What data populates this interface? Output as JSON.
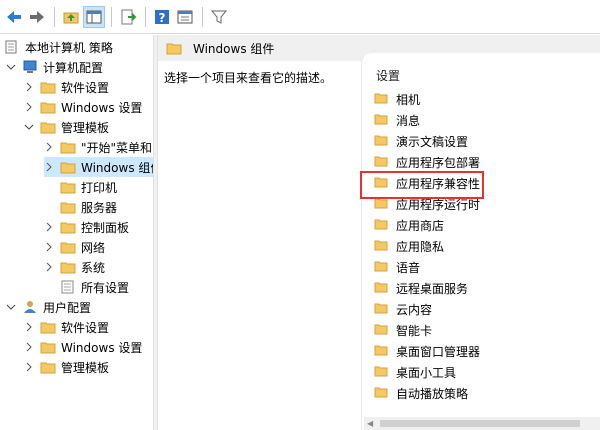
{
  "toolbar": {
    "buttons": [
      {
        "name": "back-arrow-icon"
      },
      {
        "name": "forward-arrow-icon"
      },
      {
        "name": "up-folder-icon"
      },
      {
        "name": "show-hide-tree-icon"
      },
      {
        "name": "export-list-icon"
      },
      {
        "name": "help-icon"
      },
      {
        "name": "properties-view-icon"
      },
      {
        "name": "filter-icon"
      }
    ]
  },
  "tree": {
    "items": [
      {
        "label": "本地计算机 策略",
        "level": 0,
        "expanded": true
      },
      {
        "label": "计算机配置",
        "level": 1,
        "expanded": true
      },
      {
        "label": "软件设置",
        "level": 2,
        "expanded": false
      },
      {
        "label": "Windows 设置",
        "level": 2,
        "expanded": false
      },
      {
        "label": "管理模板",
        "level": 2,
        "expanded": true
      },
      {
        "label": "\"开始\"菜单和",
        "level": 3,
        "expanded": false
      },
      {
        "label": "Windows 组件",
        "level": 3,
        "expanded": false,
        "selected": true
      },
      {
        "label": "打印机",
        "level": 3
      },
      {
        "label": "服务器",
        "level": 3
      },
      {
        "label": "控制面板",
        "level": 3,
        "expanded": false
      },
      {
        "label": "网络",
        "level": 3,
        "expanded": false
      },
      {
        "label": "系统",
        "level": 3,
        "expanded": false
      },
      {
        "label": "所有设置",
        "level": 3
      },
      {
        "label": "用户配置",
        "level": 1,
        "expanded": true
      },
      {
        "label": "软件设置",
        "level": 2,
        "expanded": false
      },
      {
        "label": "Windows 设置",
        "level": 2,
        "expanded": false
      },
      {
        "label": "管理模板",
        "level": 2,
        "expanded": false
      }
    ]
  },
  "right": {
    "header_title": "Windows 组件",
    "description": "选择一个项目来查看它的描述。",
    "column_header": "设置",
    "items": [
      "相机",
      "消息",
      "演示文稿设置",
      "应用程序包部署",
      "应用程序兼容性",
      "应用程序运行时",
      "应用商店",
      "应用隐私",
      "语音",
      "远程桌面服务",
      "云内容",
      "智能卡",
      "桌面窗口管理器",
      "桌面小工具",
      "自动播放策略"
    ],
    "highlighted_item": "应用程序兼容性"
  },
  "colors": {
    "selection": "#cce8ff",
    "highlight_border": "#e8302c",
    "folder": "#f4c862"
  }
}
